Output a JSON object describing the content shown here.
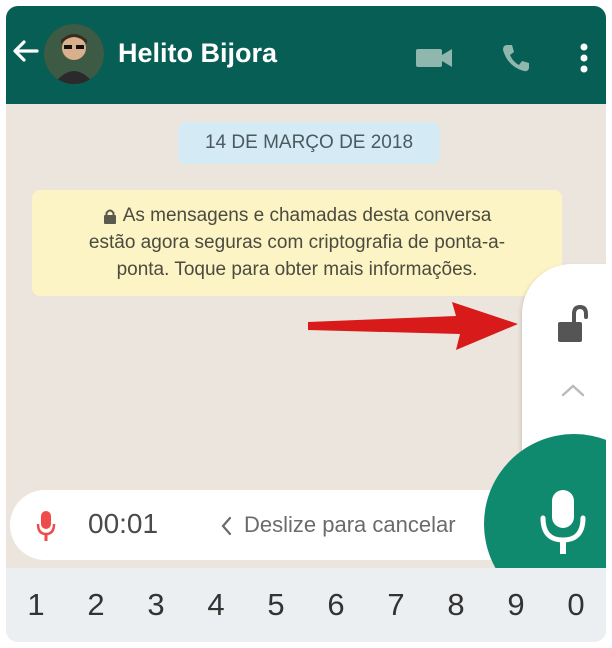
{
  "header": {
    "contact_name": "Helito Bijora",
    "icons": [
      "back-arrow-icon",
      "video-call-icon",
      "phone-icon",
      "more-vert-icon"
    ]
  },
  "chat": {
    "date_chip": "14 DE MARÇO DE 2018",
    "notice_lines": [
      "As mensagens e chamadas desta conversa",
      "estão agora seguras com criptografia de ponta-a-",
      "ponta. Toque para obter mais informações."
    ]
  },
  "recording": {
    "time": "00:01",
    "slide_to_cancel": "Deslize para cancelar"
  },
  "keyboard": {
    "keys": [
      "1",
      "2",
      "3",
      "4",
      "5",
      "6",
      "7",
      "8",
      "9",
      "0"
    ]
  },
  "colors": {
    "header_bg": "#075e54",
    "mic_button": "#0f8a6e",
    "arrow": "#d91a1a"
  }
}
